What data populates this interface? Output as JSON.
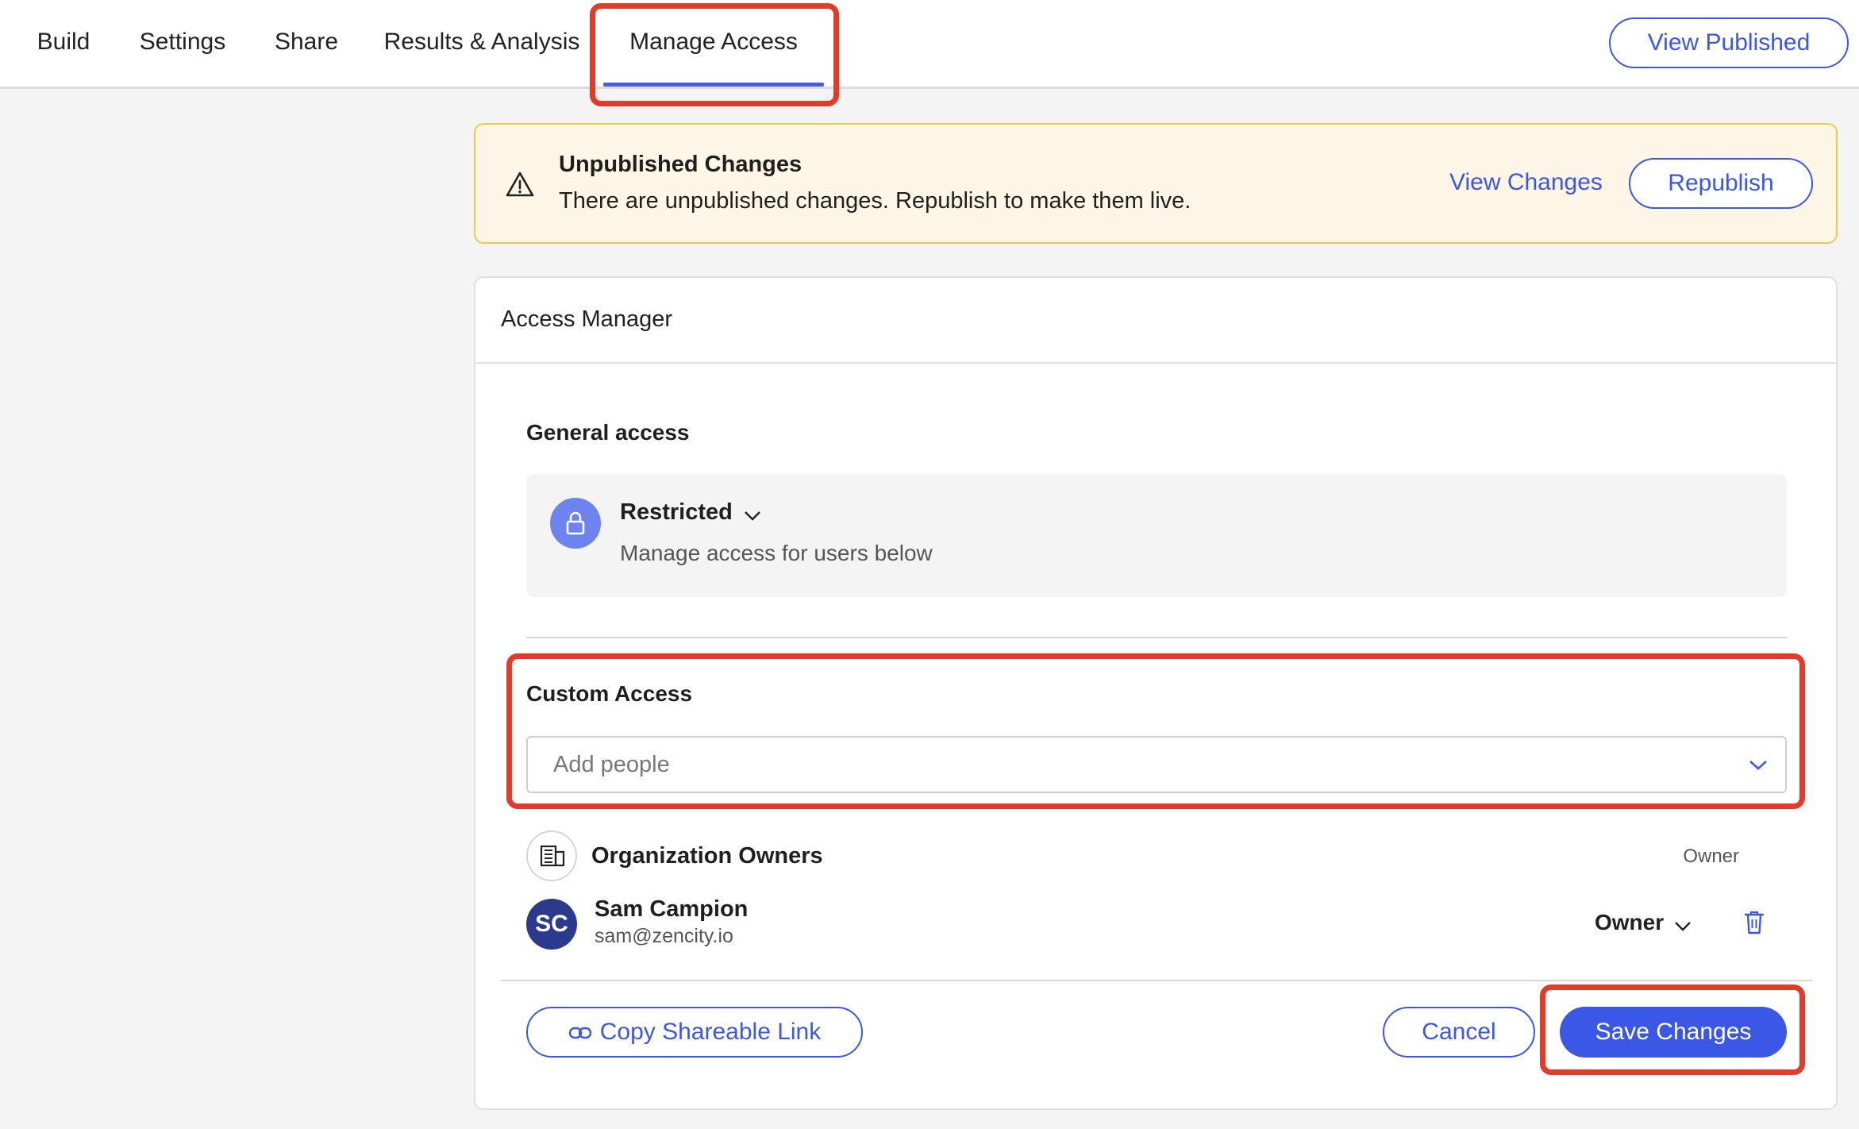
{
  "nav": {
    "tabs": [
      {
        "label": "Build"
      },
      {
        "label": "Settings"
      },
      {
        "label": "Share"
      },
      {
        "label": "Results & Analysis"
      },
      {
        "label": "Manage Access"
      }
    ],
    "view_published_label": "View Published"
  },
  "banner": {
    "icon": "warning-icon",
    "title": "Unpublished Changes",
    "message": "There are unpublished changes. Republish to make them live.",
    "view_changes_label": "View Changes",
    "republish_label": "Republish"
  },
  "access_manager": {
    "title": "Access Manager",
    "general_access": {
      "heading": "General access",
      "icon": "lock-icon",
      "mode": "Restricted",
      "description": "Manage access for users below"
    },
    "custom_access": {
      "heading": "Custom Access",
      "placeholder": "Add people"
    },
    "members": [
      {
        "name": "Organization Owners",
        "role": "Owner",
        "icon": "building-icon"
      },
      {
        "initials": "SC",
        "name": "Sam Campion",
        "email": "sam@zencity.io",
        "role": "Owner"
      }
    ],
    "footer": {
      "copy_link_label": "Copy Shareable Link",
      "cancel_label": "Cancel",
      "save_label": "Save Changes"
    }
  },
  "colors": {
    "accent": "#3b57e6",
    "highlight": "#e23b2a",
    "banner_bg": "#fdf6e6",
    "avatar_bg": "#2c3a8e"
  }
}
